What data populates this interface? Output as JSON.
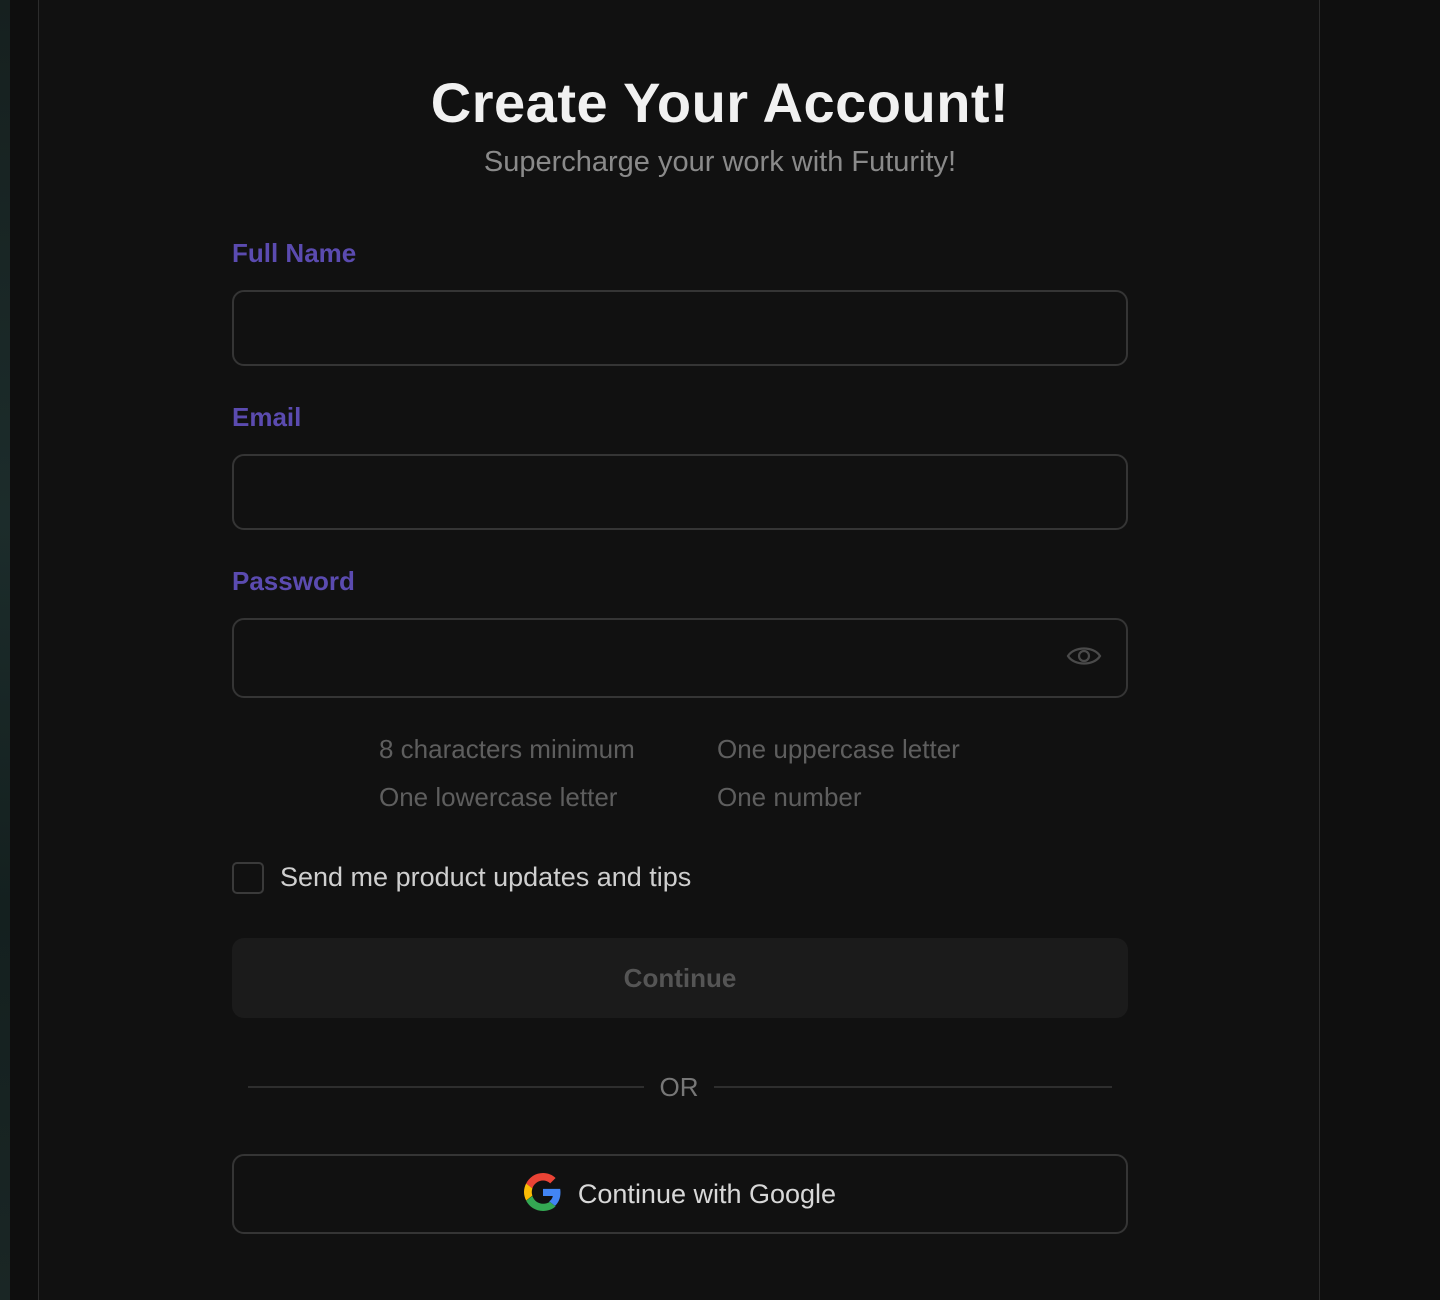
{
  "header": {
    "title": "Create Your Account!",
    "subtitle": "Supercharge your work with Futurity!"
  },
  "form": {
    "full_name": {
      "label": "Full Name",
      "value": "",
      "placeholder": ""
    },
    "email": {
      "label": "Email",
      "value": "",
      "placeholder": ""
    },
    "password": {
      "label": "Password",
      "value": "",
      "placeholder": "",
      "toggle_icon": "eye-icon"
    },
    "requirements": [
      "8 characters minimum",
      "One uppercase letter",
      "One lowercase letter",
      "One number"
    ],
    "updates_checkbox": {
      "label": "Send me product updates and tips",
      "checked": false
    },
    "continue_label": "Continue",
    "divider_text": "OR",
    "google_label": "Continue with Google"
  },
  "colors": {
    "background": "#111111",
    "label_accent": "#5b4bb0",
    "title": "#f1f1f1",
    "muted": "#5e5e5e",
    "google_blue": "#4285F4",
    "google_red": "#EA4335",
    "google_yellow": "#FBBC05",
    "google_green": "#34A853"
  }
}
